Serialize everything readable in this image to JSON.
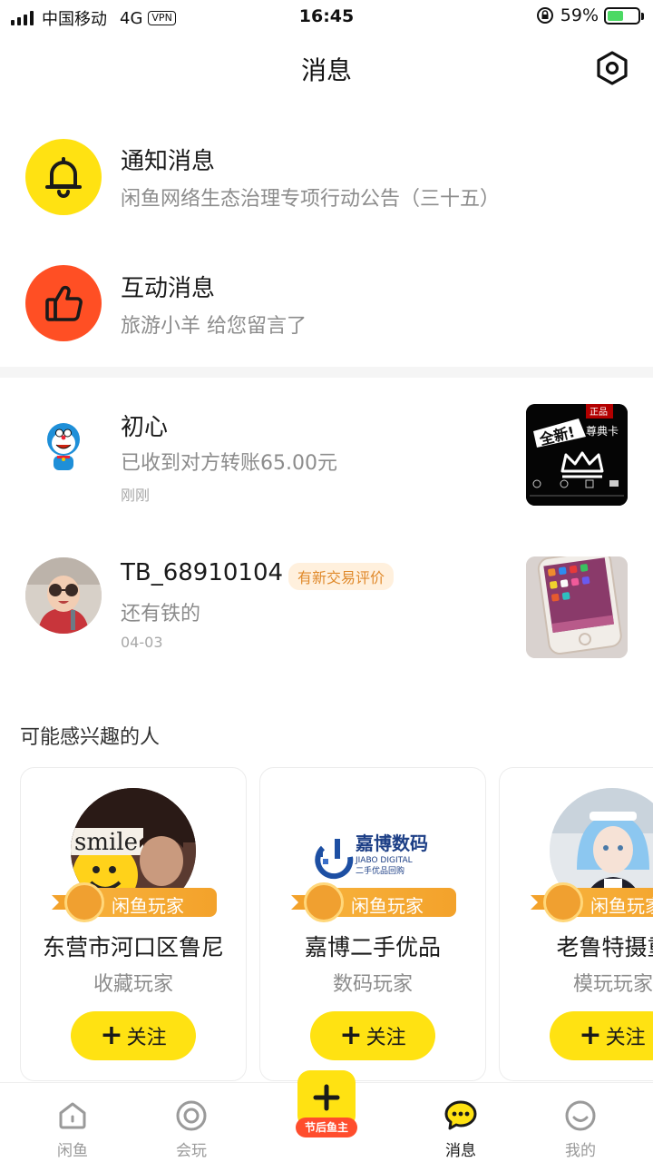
{
  "status_bar": {
    "carrier": "中国移动",
    "network": "4G",
    "vpn": "VPN",
    "time": "16:45",
    "battery_percent": "59%",
    "battery_level": 0.59
  },
  "header": {
    "title": "消息"
  },
  "system_messages": [
    {
      "title": "通知消息",
      "subtitle": "闲鱼网络生态治理专项行动公告（三十五）",
      "icon": "bell-icon",
      "color": "#ffe212"
    },
    {
      "title": "互动消息",
      "subtitle": "旅游小羊 给您留言了",
      "icon": "thumbs-up-icon",
      "color": "#ff4f24"
    }
  ],
  "chats": [
    {
      "name": "初心",
      "preview": "已收到对方转账65.00元",
      "time": "刚刚",
      "thumb": {
        "corner": "正品",
        "text1": "全新!",
        "text2": "尊典卡"
      }
    },
    {
      "name": "TB_68910104",
      "badge": "有新交易评价",
      "preview": "还有铁的",
      "time": "04-03"
    }
  ],
  "suggestions": {
    "title": "可能感兴趣的人",
    "badge_label": "闲鱼玩家",
    "follow_label": "关注",
    "users": [
      {
        "name": "东营市河口区鲁尼",
        "tag": "收藏玩家",
        "avatar_text": "smile"
      },
      {
        "name": "嘉博二手优品",
        "tag": "数码玩家",
        "logo_title": "嘉博数码",
        "logo_sub1": "JIABO DIGITAL",
        "logo_sub2": "二手优品回购"
      },
      {
        "name": "老鲁特摄重",
        "tag": "模玩玩家"
      }
    ]
  },
  "bottom_nav": {
    "items": [
      {
        "label": "闲鱼",
        "icon": "home-icon"
      },
      {
        "label": "会玩",
        "icon": "circle-icon"
      },
      {
        "label": "节后鱼主",
        "icon": "plus-icon"
      },
      {
        "label": "消息",
        "icon": "chat-icon",
        "active": true
      },
      {
        "label": "我的",
        "icon": "smile-icon"
      }
    ]
  },
  "colors": {
    "accent_yellow": "#ffe212",
    "accent_red": "#ff4f24",
    "badge_orange": "#e08a2c"
  }
}
